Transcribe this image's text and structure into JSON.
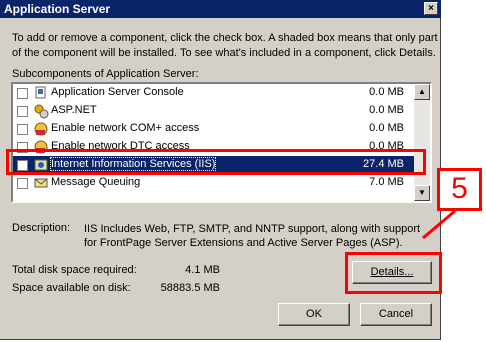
{
  "window": {
    "title": "Application Server",
    "close_glyph": "×"
  },
  "instructions": "To add or remove a component, click the check box. A shaded box means that only part\nof the component will be installed. To see what's included in a component, click Details.",
  "list_label": "Subcomponents of Application Server:",
  "components": [
    {
      "name": "Application Server Console",
      "size": "0.0 MB",
      "icon": "console-icon",
      "selected": false
    },
    {
      "name": "ASP.NET",
      "size": "0.0 MB",
      "icon": "gears-icon",
      "selected": false
    },
    {
      "name": "Enable network COM+ access",
      "size": "0.0 MB",
      "icon": "network-icon",
      "selected": false
    },
    {
      "name": "Enable network DTC access",
      "size": "0.0 MB",
      "icon": "network-icon",
      "selected": false
    },
    {
      "name": "Internet Information Services (IIS)",
      "size": "27.4 MB",
      "icon": "iis-icon",
      "selected": true
    },
    {
      "name": "Message Queuing",
      "size": "7.0 MB",
      "icon": "mail-icon",
      "selected": false
    }
  ],
  "description": {
    "label": "Description:",
    "text": "IIS Includes Web, FTP, SMTP, and NNTP support, along with support\nfor FrontPage Server Extensions and Active Server Pages (ASP)."
  },
  "disk": {
    "required_label": "Total disk space required:",
    "required_value": "4.1 MB",
    "available_label": "Space available on disk:",
    "available_value": "58883.5 MB"
  },
  "buttons": {
    "details": "Details...",
    "ok": "OK",
    "cancel": "Cancel"
  },
  "annotation": {
    "step_number": "5",
    "color": "#ff0000"
  }
}
